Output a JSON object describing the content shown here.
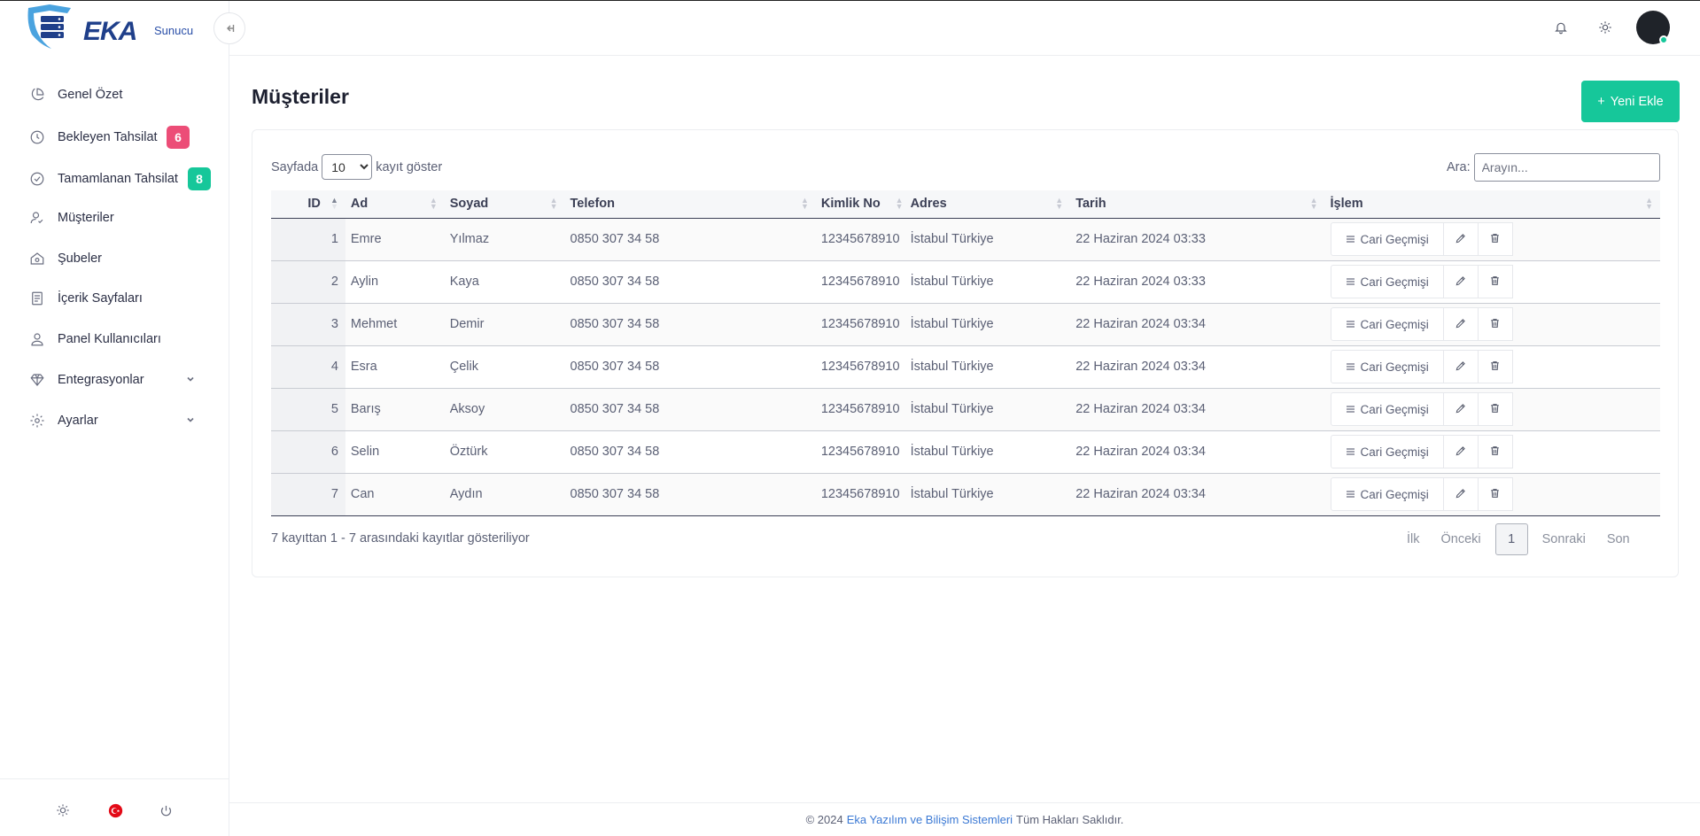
{
  "brand": {
    "name": "EKA",
    "sub": "Sunucu",
    "shield_color": "#4aa3df",
    "text_color": "#1f3f8a"
  },
  "sidebar": {
    "items": [
      {
        "label": "Genel Özet",
        "icon": "pie-chart-icon"
      },
      {
        "label": "Bekleyen Tahsilat",
        "icon": "clock-icon",
        "badge": "6",
        "badge_color": "#ec4d77"
      },
      {
        "label": "Tamamlanan Tahsilat",
        "icon": "check-circle-icon",
        "badge": "8",
        "badge_color": "#16c79a"
      },
      {
        "label": "Müşteriler",
        "icon": "user-check-icon"
      },
      {
        "label": "Şubeler",
        "icon": "home-icon"
      },
      {
        "label": "İçerik Sayfaları",
        "icon": "document-icon"
      },
      {
        "label": "Panel Kullanıcıları",
        "icon": "user-icon"
      },
      {
        "label": "Entegrasyonlar",
        "icon": "diamond-icon",
        "expandable": true
      },
      {
        "label": "Ayarlar",
        "icon": "settings-icon",
        "expandable": true
      }
    ],
    "footer_icons": [
      "sun-icon",
      "turkey-flag-icon",
      "power-icon"
    ]
  },
  "header": {
    "icons": [
      "bell-icon",
      "sun-icon"
    ],
    "avatar_status_color": "#16c79a"
  },
  "page": {
    "title": "Müşteriler",
    "add_label": "Yeni Ekle",
    "accent": "#16c79a"
  },
  "table_controls": {
    "length_prefix": "Sayfada",
    "length_value": "10",
    "length_suffix": "kayıt göster",
    "search_label": "Ara:",
    "search_placeholder": "Arayın..."
  },
  "table": {
    "columns": [
      "ID",
      "Ad",
      "Soyad",
      "Telefon",
      "Kimlik No",
      "Adres",
      "Tarih",
      "İşlem"
    ],
    "action_label": "Cari Geçmişi",
    "rows": [
      {
        "id": "1",
        "ad": "Emre",
        "soyad": "Yılmaz",
        "telefon": "0850 307 34 58",
        "kimlik": "12345678910",
        "adres": "İstabul Türkiye",
        "tarih": "22 Haziran 2024 03:33"
      },
      {
        "id": "2",
        "ad": "Aylin",
        "soyad": "Kaya",
        "telefon": "0850 307 34 58",
        "kimlik": "12345678910",
        "adres": "İstabul Türkiye",
        "tarih": "22 Haziran 2024 03:33"
      },
      {
        "id": "3",
        "ad": "Mehmet",
        "soyad": "Demir",
        "telefon": "0850 307 34 58",
        "kimlik": "12345678910",
        "adres": "İstabul Türkiye",
        "tarih": "22 Haziran 2024 03:34"
      },
      {
        "id": "4",
        "ad": "Esra",
        "soyad": "Çelik",
        "telefon": "0850 307 34 58",
        "kimlik": "12345678910",
        "adres": "İstabul Türkiye",
        "tarih": "22 Haziran 2024 03:34"
      },
      {
        "id": "5",
        "ad": "Barış",
        "soyad": "Aksoy",
        "telefon": "0850 307 34 58",
        "kimlik": "12345678910",
        "adres": "İstabul Türkiye",
        "tarih": "22 Haziran 2024 03:34"
      },
      {
        "id": "6",
        "ad": "Selin",
        "soyad": "Öztürk",
        "telefon": "0850 307 34 58",
        "kimlik": "12345678910",
        "adres": "İstabul Türkiye",
        "tarih": "22 Haziran 2024 03:34"
      },
      {
        "id": "7",
        "ad": "Can",
        "soyad": "Aydın",
        "telefon": "0850 307 34 58",
        "kimlik": "12345678910",
        "adres": "İstabul Türkiye",
        "tarih": "22 Haziran 2024 03:34"
      }
    ]
  },
  "table_info": "7 kayıttan 1 - 7 arasındaki kayıtlar gösteriliyor",
  "pagination": {
    "first": "İlk",
    "prev": "Önceki",
    "current": "1",
    "next": "Sonraki",
    "last": "Son"
  },
  "footer": {
    "prefix": "© 2024",
    "link": "Eka Yazılım ve Bilişim Sistemleri",
    "suffix": "Tüm Hakları Saklıdır."
  }
}
